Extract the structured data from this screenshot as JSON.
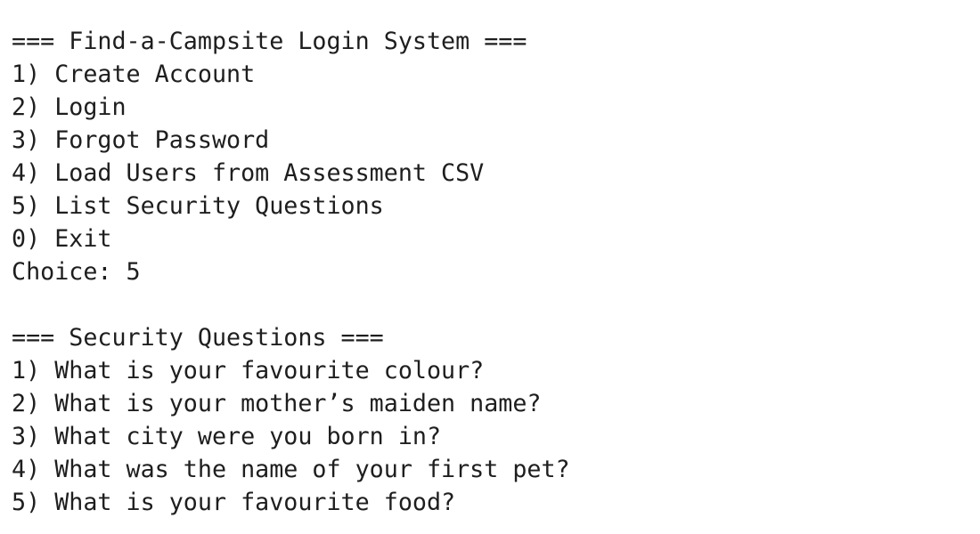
{
  "login_menu": {
    "header": "=== Find-a-Campsite Login System ===",
    "options": [
      "1) Create Account",
      "2) Login",
      "3) Forgot Password",
      "4) Load Users from Assessment CSV",
      "5) List Security Questions",
      "0) Exit"
    ],
    "prompt": "Choice: ",
    "input_value": "5"
  },
  "security_questions": {
    "header": "=== Security Questions ===",
    "items": [
      "1) What is your favourite colour?",
      "2) What is your mother’s maiden name?",
      "3) What city were you born in?",
      "4) What was the name of your first pet?",
      "5) What is your favourite food?"
    ]
  }
}
